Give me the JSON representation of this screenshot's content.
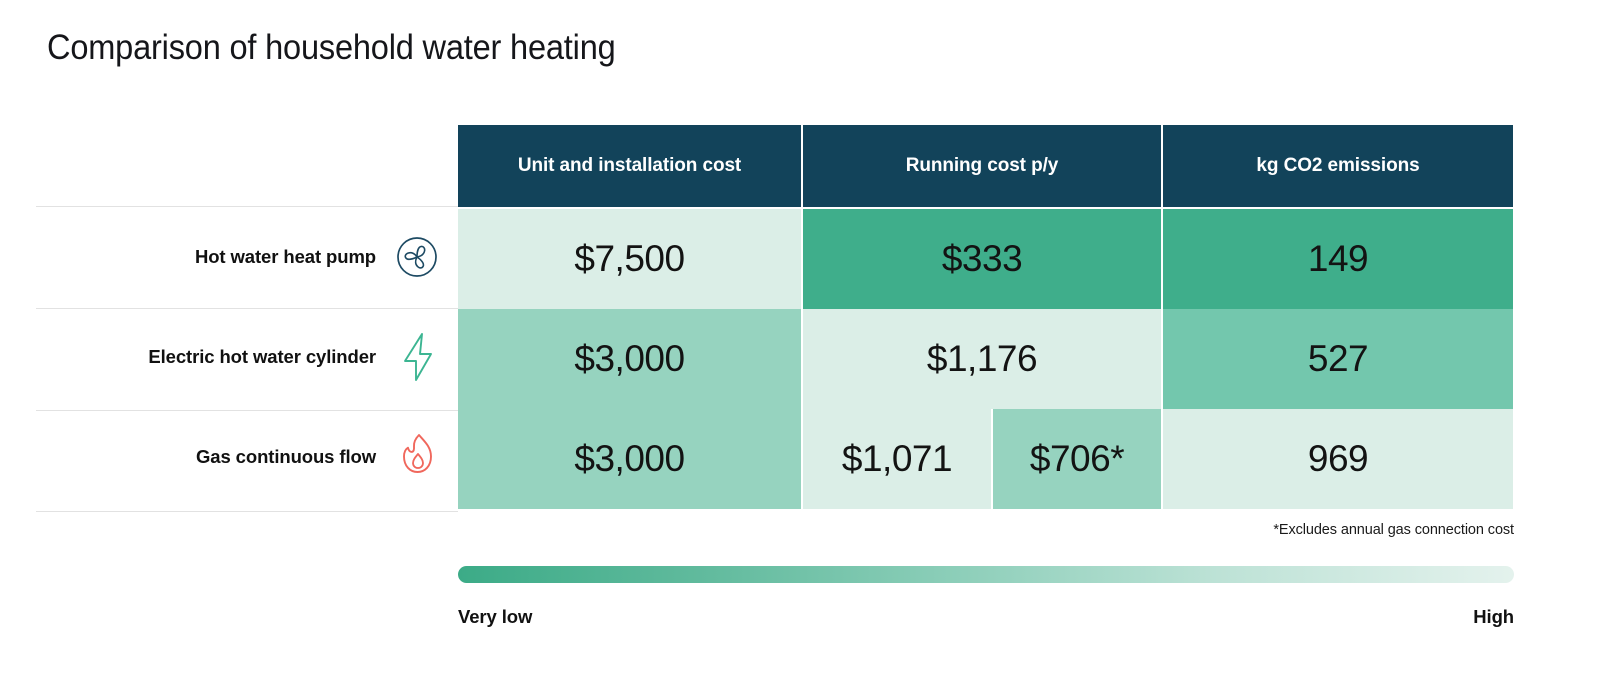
{
  "title": "Comparison of household water heating",
  "colors": {
    "header_bg": "#12435a",
    "very_low": "#3fae8b",
    "low": "#96d3bf",
    "high": "#dbeee7",
    "fan_icon": "#1d4a63",
    "bolt_icon": "#3cb592",
    "flame_icon": "#f0675c"
  },
  "table": {
    "columns": [
      {
        "label": "Unit and installation cost"
      },
      {
        "label": "Running cost p/y"
      },
      {
        "label": "kg CO2 emissions"
      }
    ],
    "rows": [
      {
        "label": "Hot water heat pump",
        "icon": "fan-icon",
        "unit_cost": "$7,500",
        "unit_cost_level": "high",
        "running_cost": "$333",
        "running_cost_level": "very_low",
        "co2": "149",
        "co2_level": "very_low"
      },
      {
        "label": "Electric hot water cylinder",
        "icon": "lightning-bolt-icon",
        "unit_cost": "$3,000",
        "unit_cost_level": "low",
        "running_cost": "$1,176",
        "running_cost_level": "high",
        "co2": "527",
        "co2_level": "low"
      },
      {
        "label": "Gas continuous flow",
        "icon": "flame-icon",
        "unit_cost": "$3,000",
        "unit_cost_level": "low",
        "running_cost": "$1,071",
        "running_cost_level": "high",
        "running_cost_alt": "$706*",
        "running_cost_alt_level": "low",
        "co2": "969",
        "co2_level": "high"
      }
    ]
  },
  "footnote": "*Excludes annual gas connection cost",
  "legend": {
    "low_label": "Very low",
    "high_label": "High"
  },
  "chart_data": {
    "type": "heatmap",
    "title": "Comparison of household water heating",
    "xlabel": "",
    "ylabel": "",
    "categories": [
      "Unit and installation cost",
      "Running cost p/y",
      "kg CO2 emissions"
    ],
    "rows": [
      "Hot water heat pump",
      "Electric hot water cylinder",
      "Gas continuous flow"
    ],
    "series": [
      {
        "name": "Hot water heat pump",
        "values": [
          7500,
          333,
          149
        ],
        "display": [
          "$7,500",
          "$333",
          "149"
        ],
        "levels": [
          "high",
          "very_low",
          "very_low"
        ]
      },
      {
        "name": "Electric hot water cylinder",
        "values": [
          3000,
          1176,
          527
        ],
        "display": [
          "$3,000",
          "$1,176",
          "527"
        ],
        "levels": [
          "low",
          "high",
          "low"
        ]
      },
      {
        "name": "Gas continuous flow",
        "values": [
          3000,
          1071,
          969
        ],
        "display": [
          "$3,000",
          "$1,071",
          "969"
        ],
        "levels": [
          "low",
          "high",
          "high"
        ],
        "secondary": {
          "column": "Running cost p/y",
          "value": 706,
          "display": "$706*",
          "level": "low",
          "note": "*Excludes annual gas connection cost"
        }
      }
    ],
    "legend": {
      "position": "bottom",
      "type": "gradient",
      "low": "Very low",
      "high": "High"
    },
    "grid": false
  }
}
